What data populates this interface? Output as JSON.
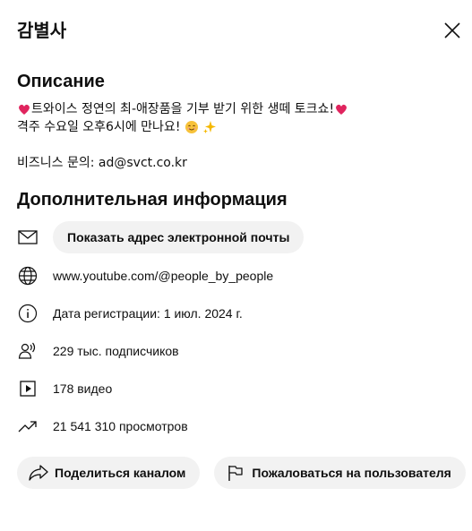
{
  "header": {
    "title": "감별사",
    "close_icon": "close-icon"
  },
  "description": {
    "heading": "Описание",
    "line1_text": "트와이스 정연의 최-애장품을 기부 받기 위한 생떼 토크쇼!",
    "line2_text": "격주 수요일 오후6시에 만나요!",
    "business_contact": "비즈니스 문의: ad@svct.co.kr",
    "emoji_names": [
      "heart-emoji",
      "heart-emoji",
      "smile-emoji",
      "sparkles-emoji"
    ]
  },
  "additional": {
    "heading": "Дополнительная информация",
    "show_email_button": "Показать адрес электронной почты",
    "channel_url": "www.youtube.com/@people_by_people",
    "registration": "Дата регистрации: 1 июл. 2024 г.",
    "subscribers": "229 тыс. подписчиков",
    "videos": "178 видео",
    "views": "21 541 310 просмотров"
  },
  "actions": {
    "share_label": "Поделиться каналом",
    "report_label": "Пожаловаться на пользователя"
  },
  "colors": {
    "text": "#0f0f0f",
    "pill_bg": "#f2f2f2",
    "heart": "#e0245e"
  }
}
